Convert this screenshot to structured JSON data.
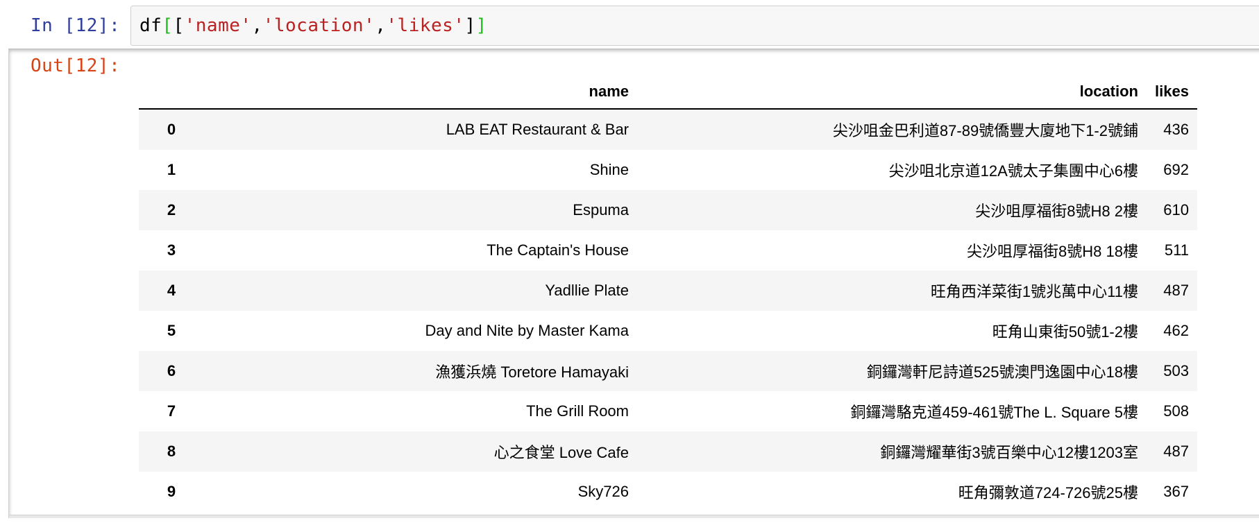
{
  "input": {
    "prompt": "In [12]:",
    "code": {
      "var": "df",
      "open_outer": "[",
      "open_inner": "[",
      "str1": "'name'",
      "comma1": ",",
      "str2": "'location'",
      "comma2": ",",
      "str3": "'likes'",
      "close_inner": "]",
      "close_outer": "]"
    }
  },
  "output": {
    "prompt": "Out[12]:",
    "table": {
      "index_header": "",
      "columns": [
        "name",
        "location",
        "likes"
      ],
      "rows": [
        {
          "index": "0",
          "name": "LAB EAT Restaurant & Bar",
          "location": "尖沙咀金巴利道87-89號僑豐大廈地下1-2號鋪",
          "likes": "436"
        },
        {
          "index": "1",
          "name": "Shine",
          "location": "尖沙咀北京道12A號太子集團中心6樓",
          "likes": "692"
        },
        {
          "index": "2",
          "name": "Espuma",
          "location": "尖沙咀厚福街8號H8 2樓",
          "likes": "610"
        },
        {
          "index": "3",
          "name": "The Captain's House",
          "location": "尖沙咀厚福街8號H8 18樓",
          "likes": "511"
        },
        {
          "index": "4",
          "name": "Yadllie Plate",
          "location": "旺角西洋菜街1號兆萬中心11樓",
          "likes": "487"
        },
        {
          "index": "5",
          "name": "Day and Nite by Master Kama",
          "location": "旺角山東街50號1-2樓",
          "likes": "462"
        },
        {
          "index": "6",
          "name": "漁獲浜燒 Toretore Hamayaki",
          "location": "銅鑼灣軒尼詩道525號澳門逸園中心18樓",
          "likes": "503"
        },
        {
          "index": "7",
          "name": "The Grill Room",
          "location": "銅鑼灣駱克道459-461號The L. Square 5樓",
          "likes": "508"
        },
        {
          "index": "8",
          "name": "心之食堂 Love Cafe",
          "location": "銅鑼灣耀華街3號百樂中心12樓1203室",
          "likes": "487"
        },
        {
          "index": "9",
          "name": "Sky726",
          "location": "旺角彌敦道724-726號25樓",
          "likes": "367"
        }
      ]
    }
  }
}
